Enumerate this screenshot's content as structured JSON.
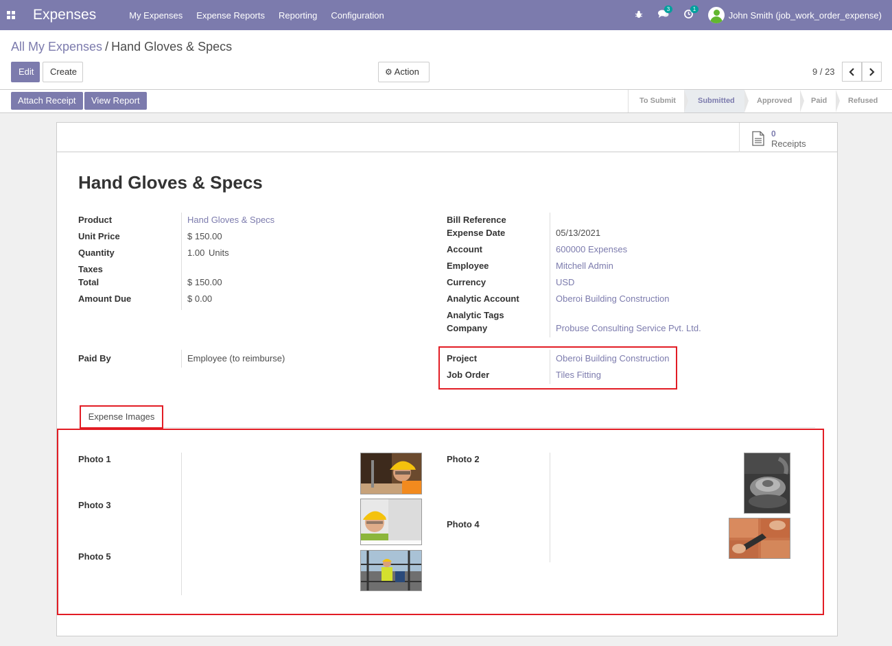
{
  "navbar": {
    "app_title": "Expenses",
    "menu": [
      "My Expenses",
      "Expense Reports",
      "Reporting",
      "Configuration"
    ],
    "messages_count": "3",
    "activities_count": "1",
    "user": "John Smith (job_work_order_expense)"
  },
  "breadcrumb": {
    "parent": "All My Expenses",
    "separator": "/",
    "current": "Hand Gloves & Specs"
  },
  "buttons": {
    "edit": "Edit",
    "create": "Create",
    "action": "Action",
    "attach_receipt": "Attach Receipt",
    "view_report": "View Report"
  },
  "pager": {
    "value": "9 / 23"
  },
  "stages": [
    {
      "label": "To Submit",
      "active": false
    },
    {
      "label": "Submitted",
      "active": true
    },
    {
      "label": "Approved",
      "active": false
    },
    {
      "label": "Paid",
      "active": false
    },
    {
      "label": "Refused",
      "active": false
    }
  ],
  "smart_button": {
    "count": "0",
    "label": "Receipts"
  },
  "record": {
    "title": "Hand Gloves & Specs",
    "left_fields": {
      "product_label": "Product",
      "product_value": "Hand Gloves & Specs",
      "unit_price_label": "Unit Price",
      "unit_price_value": "$ 150.00",
      "quantity_label": "Quantity",
      "quantity_value": "1.00",
      "quantity_uom": "Units",
      "taxes_label": "Taxes",
      "total_label": "Total",
      "total_value": "$ 150.00",
      "amount_due_label": "Amount Due",
      "amount_due_value": "$ 0.00",
      "paid_by_label": "Paid By",
      "paid_by_value": "Employee (to reimburse)"
    },
    "right_fields": {
      "bill_reference_label": "Bill Reference",
      "expense_date_label": "Expense Date",
      "expense_date_value": "05/13/2021",
      "account_label": "Account",
      "account_value": "600000 Expenses",
      "employee_label": "Employee",
      "employee_value": "Mitchell Admin",
      "currency_label": "Currency",
      "currency_value": "USD",
      "analytic_account_label": "Analytic Account",
      "analytic_account_value": "Oberoi Building Construction",
      "analytic_tags_label": "Analytic Tags",
      "company_label": "Company",
      "company_value": "Probuse Consulting Service Pvt. Ltd.",
      "project_label": "Project",
      "project_value": "Oberoi Building Construction",
      "job_order_label": "Job Order",
      "job_order_value": "Tiles Fitting"
    }
  },
  "tab": {
    "label": "Expense Images"
  },
  "photos": {
    "photo1": "Photo 1",
    "photo2": "Photo 2",
    "photo3": "Photo 3",
    "photo4": "Photo 4",
    "photo5": "Photo 5"
  },
  "colors": {
    "brand": "#7c7bad",
    "highlight": "#e21c24",
    "badge": "#00a09d"
  }
}
